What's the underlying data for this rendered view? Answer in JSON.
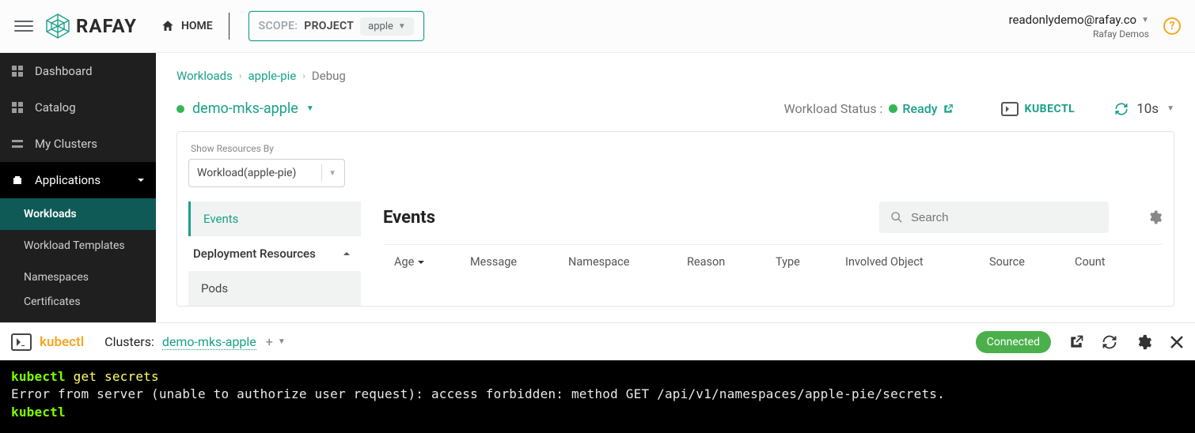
{
  "header": {
    "logo_text": "RAFAY",
    "home_label": "HOME",
    "scope_prefix": "SCOPE:",
    "scope_project_label": "PROJECT",
    "scope_value": "apple",
    "user_email": "readonlydemo@rafay.co",
    "user_org": "Rafay Demos"
  },
  "sidebar": {
    "items": [
      {
        "label": "Dashboard"
      },
      {
        "label": "Catalog"
      },
      {
        "label": "My Clusters"
      },
      {
        "label": "Applications"
      }
    ],
    "sub_items": [
      {
        "label": "Workloads"
      },
      {
        "label": "Workload Templates"
      },
      {
        "label": "Namespaces"
      },
      {
        "label": "Certificates"
      }
    ]
  },
  "breadcrumb": {
    "a": "Workloads",
    "b": "apple-pie",
    "c": "Debug"
  },
  "context": {
    "cluster_name": "demo-mks-apple",
    "status_label": "Workload Status :",
    "status_value": "Ready",
    "kubectl_btn": "KUBECTL",
    "refresh_value": "10s"
  },
  "filter": {
    "label": "Show Resources By",
    "value": "Workload(apple-pie)"
  },
  "tree": {
    "events": "Events",
    "dep_header": "Deployment Resources",
    "pods": "Pods"
  },
  "events": {
    "title": "Events",
    "search_placeholder": "Search",
    "columns": {
      "age": "Age",
      "message": "Message",
      "namespace": "Namespace",
      "reason": "Reason",
      "type": "Type",
      "involved": "Involved Object",
      "source": "Source",
      "count": "Count"
    }
  },
  "kbar": {
    "brand": "kubectl",
    "clusters_label": "Clusters:",
    "cluster_link": "demo-mks-apple",
    "connected": "Connected"
  },
  "terminal": {
    "prompt": "kubectl",
    "cmd1": " get secrets",
    "out": "Error from server (unable to authorize user request): access forbidden: method GET /api/v1/namespaces/apple-pie/secrets."
  }
}
